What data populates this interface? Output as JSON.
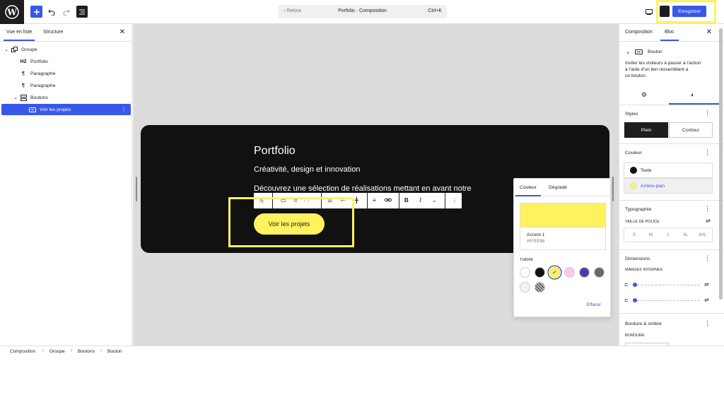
{
  "header": {
    "back_label": "Retour",
    "doc_title": "Porfolio · Composition",
    "shortcut": "Ctrl+K",
    "save_label": "Enregistrer"
  },
  "list_view": {
    "tabs": [
      "Vue en liste",
      "Structure"
    ],
    "items": [
      {
        "label": "Groupe",
        "icon": "group-icon",
        "level": 0
      },
      {
        "label": "Portfolio",
        "icon": "heading-icon",
        "icon_text": "H2",
        "level": 1
      },
      {
        "label": "Paragraphe",
        "icon": "paragraph-icon",
        "level": 1
      },
      {
        "label": "Paragraphe",
        "icon": "paragraph-icon",
        "level": 1
      },
      {
        "label": "Boutons",
        "icon": "buttons-icon",
        "level": 1
      },
      {
        "label": "Voir les projets",
        "icon": "button-icon",
        "level": 2,
        "selected": true
      }
    ]
  },
  "canvas": {
    "title": "Portfolio",
    "subtitle": "Créativité, design et innovation",
    "description": "Découvrez une sélection de réalisations mettant en avant notre",
    "cta_label": "Voir les projets"
  },
  "color_popover": {
    "tabs": [
      "Couleur",
      "Dégradé"
    ],
    "selected_name": "Accent 1",
    "selected_hex": "#FFEE58",
    "theme_label": "THÈME",
    "clear_label": "Effacer",
    "palette": [
      "#ffffff",
      "#111111",
      "#fff25f",
      "#f8c8f0",
      "#503aa8",
      "#686868",
      "#f6f2e5",
      "#888888"
    ]
  },
  "inspector": {
    "tabs": [
      "Composition",
      "Bloc"
    ],
    "block_name": "Bouton",
    "block_desc_1": "Inviter les visiteurs à passer à l’action",
    "block_desc_2": "à l’aide d’un lien ressemblant à",
    "block_desc_3": "un bouton.",
    "styles_label": "Styles",
    "style_fill": "Plein",
    "style_outline": "Contour",
    "color_label": "Couleur",
    "color_text": "Texte",
    "color_bg": "Arrière-plan",
    "typo_label": "Typographie",
    "font_size_label": "TAILLE DE POLICE",
    "font_sizes": [
      "S",
      "M",
      "L",
      "XL",
      "XXL"
    ],
    "dims_label": "Dimensions",
    "padding_label": "MARGES INTERNES",
    "border_label": "Bordure & ombre",
    "border_sub": "BORDURE"
  },
  "breadcrumb": [
    "Composition",
    "Groupe",
    "Boutons",
    "Bouton"
  ],
  "colors": {
    "accent": "#3858e9",
    "highlight": "#fff25f",
    "canvas_bg": "#dcdcdc",
    "card_bg": "#111111"
  }
}
